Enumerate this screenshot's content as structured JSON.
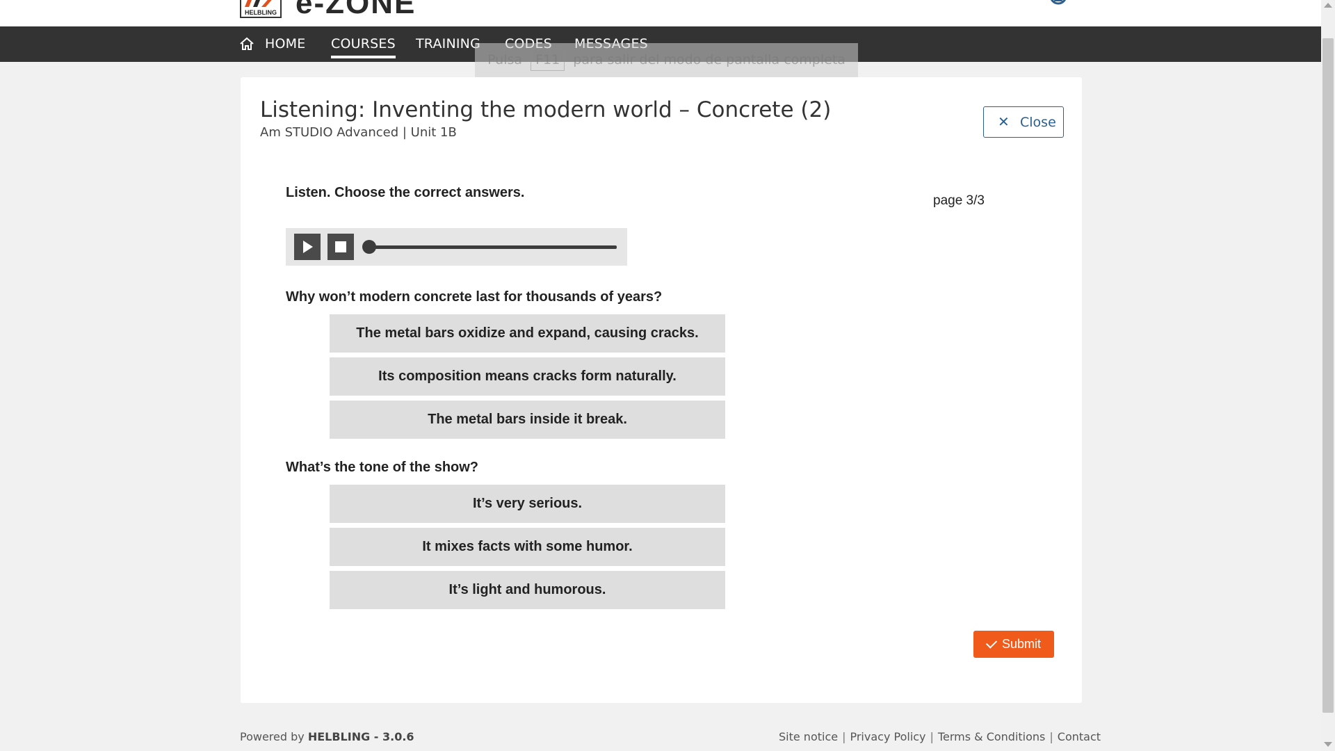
{
  "header": {
    "logo_text": "HELBLING",
    "brand": "e-ZONE"
  },
  "nav": {
    "home": "HOME",
    "courses": "COURSES",
    "training": "TRAINING",
    "codes": "CODES",
    "messages": "MESSAGES",
    "active": "COURSES"
  },
  "fullscreen_toast": {
    "pre": "Pulsa",
    "key": "F11",
    "post": "para salir del modo de pantalla completa"
  },
  "activity": {
    "title": "Listening: Inventing the modern world – Concrete (2)",
    "subtitle": "Am STUDIO Advanced | Unit 1B",
    "close_label": "Close",
    "instruction": "Listen. Choose the correct answers.",
    "page_indicator": "page 3/3",
    "audio": {
      "progress": 0
    },
    "questions": [
      {
        "text": "Why won’t modern concrete last for thousands of years?",
        "options": [
          "The metal bars oxidize and expand, causing cracks.",
          "Its composition means cracks form naturally.",
          "The metal bars inside it break."
        ]
      },
      {
        "text": "What’s the tone of the show?",
        "options": [
          "It’s very serious.",
          "It mixes facts with some humor.",
          "It’s light and humorous."
        ]
      }
    ],
    "submit_label": "Submit"
  },
  "footer": {
    "powered_prefix": "Powered by",
    "powered_brand": "HELBLING - 3.0.6",
    "links": [
      "Site notice",
      "Privacy Policy",
      "Terms & Conditions",
      "Contact"
    ]
  },
  "colors": {
    "nav_bg": "#333333",
    "accent_orange": "#f05a1a",
    "close_blue": "#2b5f8f",
    "option_bg": "#dedede"
  }
}
